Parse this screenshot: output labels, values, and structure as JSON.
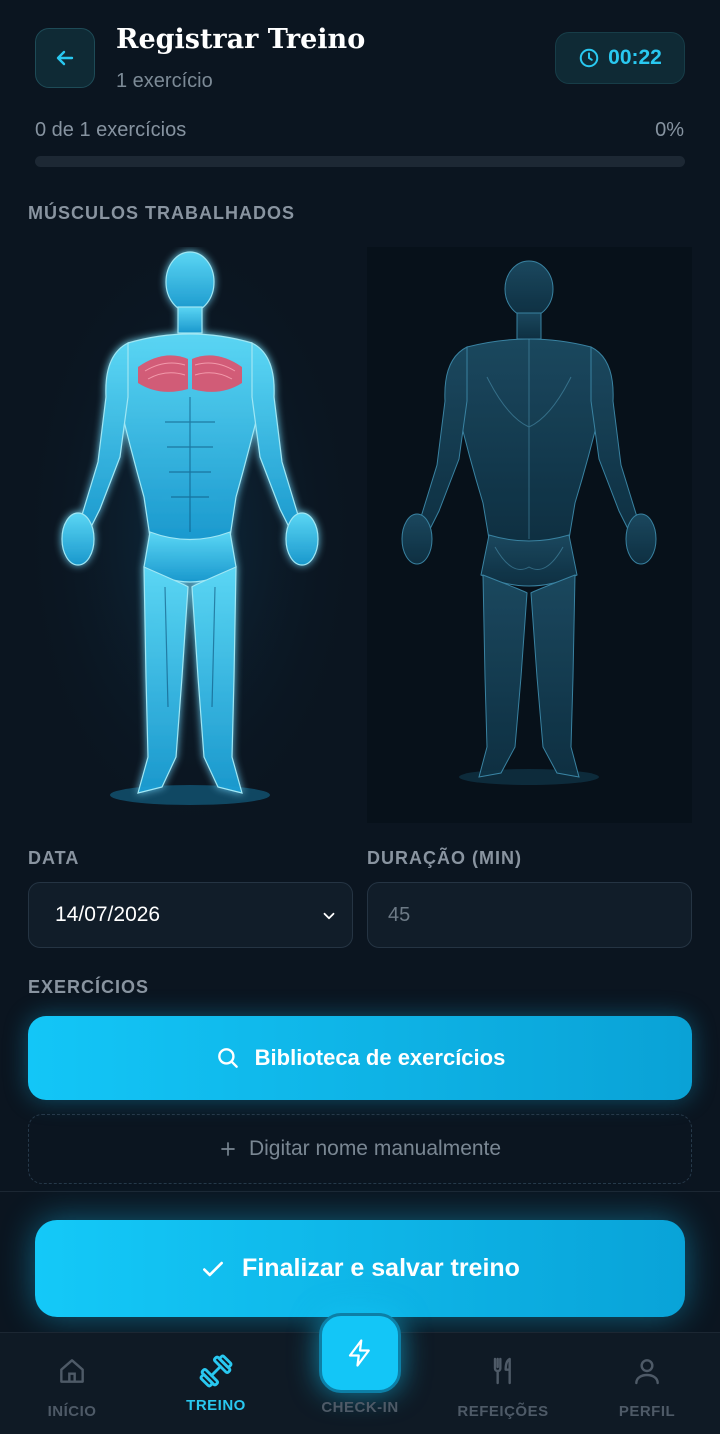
{
  "header": {
    "title": "Registrar Treino",
    "subtitle": "1 exercício",
    "timer": "00:22"
  },
  "progress": {
    "label": "0 de 1 exercícios",
    "percent_text": "0%",
    "fraction": 0
  },
  "muscles": {
    "section_title": "MÚSCULOS TRABALHADOS",
    "highlighted": "chest"
  },
  "form": {
    "date_label": "DATA",
    "date_value": "14/07/2026",
    "duration_label": "DURAÇÃO (MIN)",
    "duration_placeholder": "45"
  },
  "exercises": {
    "section_title": "EXERCÍCIOS",
    "library_button": "Biblioteca de exercícios",
    "manual_button": "Digitar nome manualmente"
  },
  "finish_button": "Finalizar e salvar treino",
  "nav": {
    "items": [
      {
        "label": "INÍCIO",
        "icon": "home-icon"
      },
      {
        "label": "TREINO",
        "icon": "dumbbell-icon",
        "active": true
      },
      {
        "label": "CHECK-IN",
        "icon": "lightning-icon"
      },
      {
        "label": "REFEIÇÕES",
        "icon": "utensils-icon"
      },
      {
        "label": "PERFIL",
        "icon": "user-icon"
      }
    ]
  },
  "colors": {
    "accent": "#29c8f0",
    "background": "#0b1520",
    "muscle_highlight": "#e0506a"
  }
}
